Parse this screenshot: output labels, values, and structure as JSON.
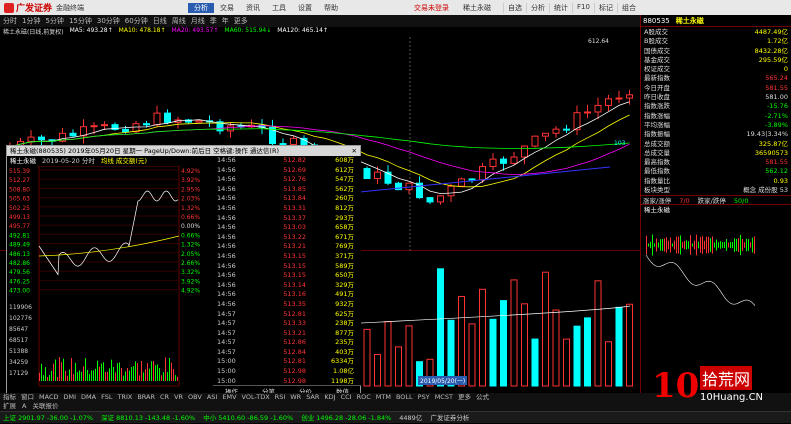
{
  "topbar": {
    "brand": "广发证券",
    "sub": "金融终端",
    "menu": [
      "分析",
      "交易",
      "资讯",
      "工具",
      "设置",
      "帮助"
    ],
    "active_menu": "分析",
    "notice": "交易未登录",
    "stock_name": "稀土永磁",
    "tools": [
      "自选",
      "分析",
      "统计",
      "F10",
      "标记",
      "组合"
    ]
  },
  "toolbar": [
    "分时",
    "1分钟",
    "5分钟",
    "15分钟",
    "30分钟",
    "60分钟",
    "日线",
    "周线",
    "月线",
    "季",
    "年",
    "更多"
  ],
  "chartinfo": {
    "title": "稀土永磁(日线,前复权)",
    "ma5": "MA5: 493.28↑",
    "ma10": "MA10: 478.18↑",
    "ma20": "MA20: 493.57↑",
    "ma60": "MA60: 515.94↓",
    "ma120": "MA120: 465.14↑"
  },
  "main_price_label": "612.64",
  "main_price_left": "103",
  "right": {
    "code": "880535",
    "name": "稀土永磁",
    "rows": [
      {
        "k": "A股成交",
        "v": "4487.49亿",
        "c": "#ff0"
      },
      {
        "k": "B股成交",
        "v": "1.72亿",
        "c": "#ff0"
      },
      {
        "k": "国债成交",
        "v": "8432.28亿",
        "c": "#ff0"
      },
      {
        "k": "基金成交",
        "v": "295.59亿",
        "c": "#ff0"
      },
      {
        "k": "权证成交",
        "v": "0",
        "c": "#ff0"
      },
      {
        "k": "最新指数",
        "v": "565.24",
        "c": "#f33"
      },
      {
        "k": "今日开盘",
        "v": "581.55",
        "c": "#f33"
      },
      {
        "k": "昨日收盘",
        "v": "581.00",
        "c": "#ddd"
      },
      {
        "k": "指数涨跌",
        "v": "-15.76",
        "c": "#0f0"
      },
      {
        "k": "指数涨幅",
        "v": "-2.71%",
        "c": "#0f0"
      },
      {
        "k": "平均涨幅",
        "v": "-3.89%",
        "c": "#0f0"
      },
      {
        "k": "指数振幅",
        "v": "19.43|3.34%",
        "c": "#ddd"
      },
      {
        "k": "总成交额",
        "v": "325.87亿",
        "c": "#ff0"
      },
      {
        "k": "总成交量",
        "v": "36590573",
        "c": "#ff0"
      },
      {
        "k": "最高指数",
        "v": "581.55",
        "c": "#f33"
      },
      {
        "k": "最低指数",
        "v": "562.12",
        "c": "#0f0"
      },
      {
        "k": "指数量比",
        "v": "0.93",
        "c": "#ff0"
      },
      {
        "k": "板块类型",
        "v": "概念 成份股 53",
        "c": "#ddd"
      }
    ],
    "tabs": [
      "涨家/涨停",
      "7/0",
      "跌家/跌停",
      "50/0"
    ],
    "mini_title": "稀土永磁"
  },
  "popup": {
    "title": "稀土永磁(880535)  2019年05月20日 星期一  PageUp/Down:前后日 空格键:操作 通达信(R)",
    "sub_title": "稀土永磁",
    "sub_info": "2019-05-20 分时",
    "sub_vol": "均线 成交额(元)",
    "left_prices": [
      "515.39",
      "512.27",
      "508.80",
      "505.63",
      "502.25",
      "499.13",
      "495.77",
      "492.81",
      "489.49",
      "486.13",
      "482.86",
      "479.56",
      "476.25",
      "473.00"
    ],
    "left_vols": [
      "119906",
      "102776",
      "85647",
      "68517",
      "51388",
      "34259",
      "17129"
    ],
    "right_pcts": [
      "4.92%",
      "3.92%",
      "2.95%",
      "2.03%",
      "1.32%",
      "0.66%",
      "0.00%",
      "0.66%",
      "1.32%",
      "2.05%",
      "2.66%",
      "3.32%",
      "3.92%",
      "4.92%"
    ],
    "ticks": [
      {
        "t": "14:56",
        "p": "512.82",
        "v": "608万"
      },
      {
        "t": "14:56",
        "p": "512.69",
        "v": "612万"
      },
      {
        "t": "14:56",
        "p": "512.76",
        "v": "547万"
      },
      {
        "t": "14:56",
        "p": "513.85",
        "v": "562万"
      },
      {
        "t": "14:56",
        "p": "513.84",
        "v": "260万"
      },
      {
        "t": "14:56",
        "p": "513.31",
        "v": "812万"
      },
      {
        "t": "14:56",
        "p": "513.37",
        "v": "293万"
      },
      {
        "t": "14:56",
        "p": "513.03",
        "v": "658万"
      },
      {
        "t": "14:56",
        "p": "513.22",
        "v": "671万"
      },
      {
        "t": "14:56",
        "p": "513.21",
        "v": "769万"
      },
      {
        "t": "14:56",
        "p": "513.15",
        "v": "371万"
      },
      {
        "t": "14:56",
        "p": "513.15",
        "v": "589万"
      },
      {
        "t": "14:56",
        "p": "513.15",
        "v": "650万"
      },
      {
        "t": "14:56",
        "p": "513.14",
        "v": "329万"
      },
      {
        "t": "14:56",
        "p": "513.16",
        "v": "491万"
      },
      {
        "t": "14:56",
        "p": "513.35",
        "v": "932万"
      },
      {
        "t": "14:57",
        "p": "512.81",
        "v": "625万"
      },
      {
        "t": "14:57",
        "p": "513.33",
        "v": "238万"
      },
      {
        "t": "14:57",
        "p": "513.21",
        "v": "877万"
      },
      {
        "t": "14:57",
        "p": "512.86",
        "v": "235万"
      },
      {
        "t": "14:57",
        "p": "512.84",
        "v": "403万"
      },
      {
        "t": "15:00",
        "p": "512.81",
        "v": "6334万"
      },
      {
        "t": "15:00",
        "p": "512.98",
        "v": "1.08亿"
      },
      {
        "t": "15:00",
        "p": "512.98",
        "v": "1198万"
      }
    ],
    "foot": [
      "操作",
      "分笔",
      "分价",
      "数值"
    ]
  },
  "vol_date": "2019/05/20(一)",
  "bottom1": [
    "指标",
    "窗口",
    "MACD",
    "DMI",
    "DMA",
    "FSL",
    "TRIX",
    "BRAR",
    "CR",
    "VR",
    "OBV",
    "ASI",
    "EMV",
    "VOL-TDX",
    "RSI",
    "WR",
    "SAR",
    "KDJ",
    "CCI",
    "ROC",
    "MTM",
    "BOLL",
    "PSY",
    "MCST",
    "更多",
    "公式"
  ],
  "bottom2": [
    "扩展",
    "A",
    "关联报价"
  ],
  "status": [
    "上证 2901.97 -36.00 -1.07%",
    "深证 8810.13 -143.48 -1.60%",
    "中小 5410.60 -86.59 -1.60%",
    "创业 1496.28 -28.06 -1.84%",
    "4489亿",
    "广发证券分析"
  ],
  "watermark": {
    "num": "10",
    "cn": "拾荒网",
    "url": "10Huang.CN"
  },
  "colors": {
    "up": "#ff3333",
    "down": "#00ffff",
    "bg": "#000000",
    "menu_active": "#2a5db0"
  }
}
